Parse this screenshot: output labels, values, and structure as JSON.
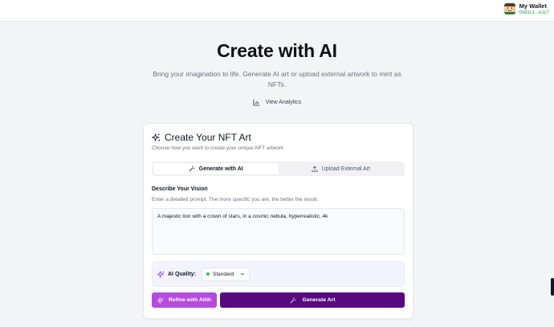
{
  "wallet": {
    "name": "My Wallet",
    "address": "0xd1c1...e1c7"
  },
  "hero": {
    "title": "Create with AI",
    "subtitle": "Bring your imagination to life. Generate AI art or upload external artwork to mint as NFTs.",
    "analytics_label": "View Analytics"
  },
  "card": {
    "title": "Create Your NFT Art",
    "subtitle": "Choose how you want to create your unique NFT artwork",
    "tabs": [
      {
        "label": "Generate with AI",
        "active": true,
        "icon": "magic-wand-icon"
      },
      {
        "label": "Upload External Art",
        "active": false,
        "icon": "upload-icon"
      }
    ],
    "prompt_label": "Describe Your Vision",
    "prompt_help": "Enter a detailed prompt. The more specific you are, the better the result.",
    "prompt_value": "A majestic lion with a crown of stars, in a cosmic nebula, hyperrealistic, 4k",
    "quality_label": "AI Quality:",
    "quality_value": "Standard",
    "refine_label": "Refine with Alith",
    "generate_label": "Generate Art"
  },
  "colors": {
    "refine": "#b44cde",
    "generate": "#57097f",
    "status_dot": "#22c55e",
    "wallet_address": "#16a34a"
  }
}
